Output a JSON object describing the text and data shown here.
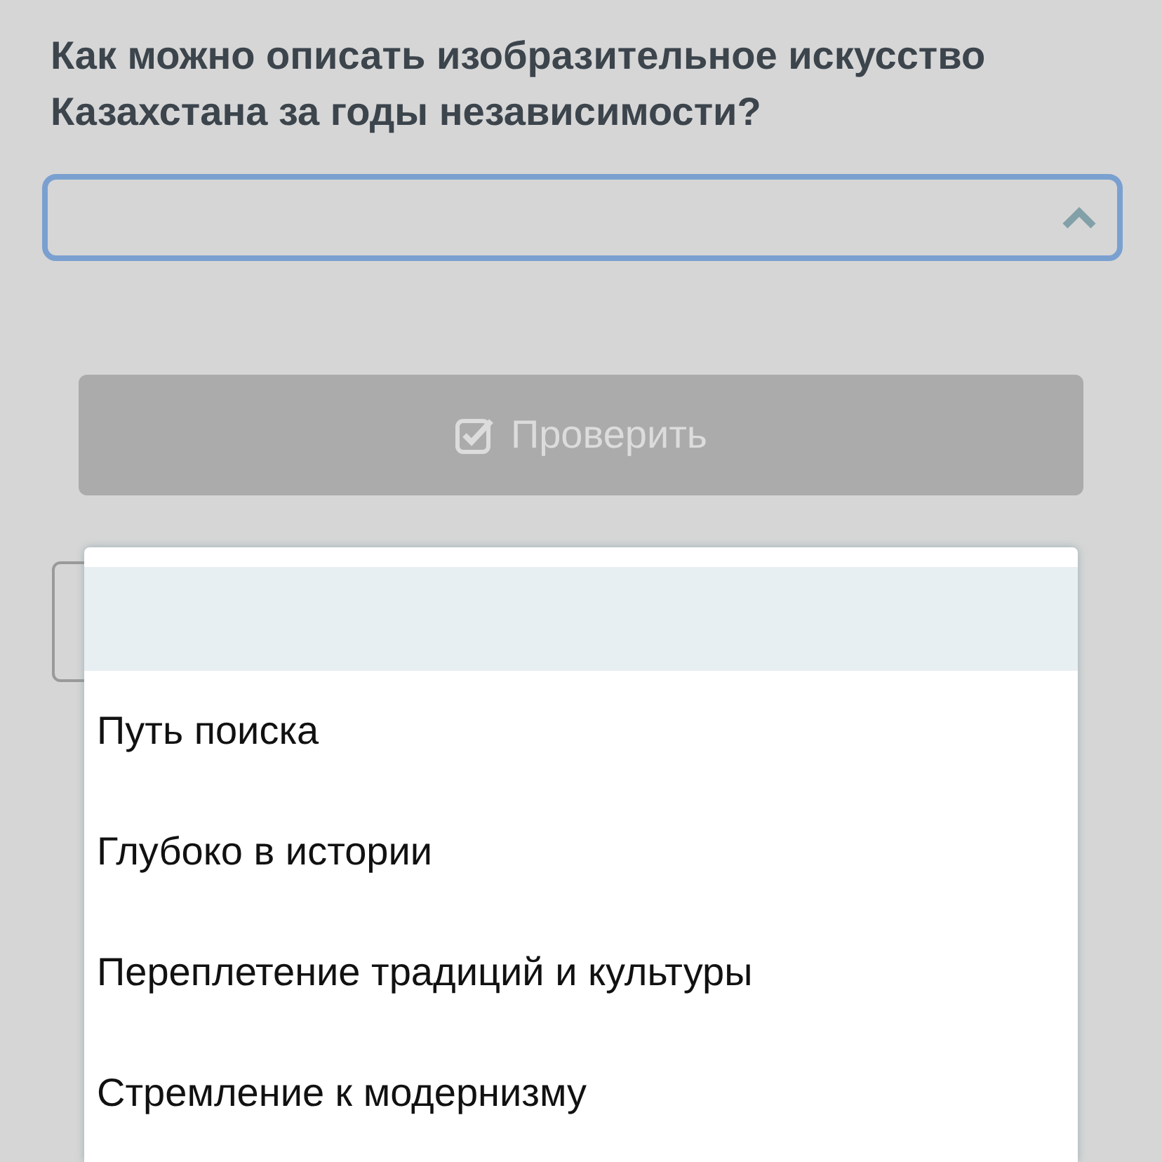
{
  "question": "Как можно описать изобразительное искусство Казахстана за годы независимости?",
  "select": {
    "expanded": true
  },
  "check_button": {
    "label": "Проверить",
    "disabled": true
  },
  "dropdown": {
    "options": [
      {
        "highlighted": true
      },
      {
        "label": "Путь поиска",
        "highlighted": false
      },
      {
        "label": "Глубоко в истории",
        "highlighted": false
      },
      {
        "label": "Переплетение традиций и культуры",
        "highlighted": false
      },
      {
        "label": "Стремление к модернизму",
        "highlighted": false
      }
    ]
  }
}
